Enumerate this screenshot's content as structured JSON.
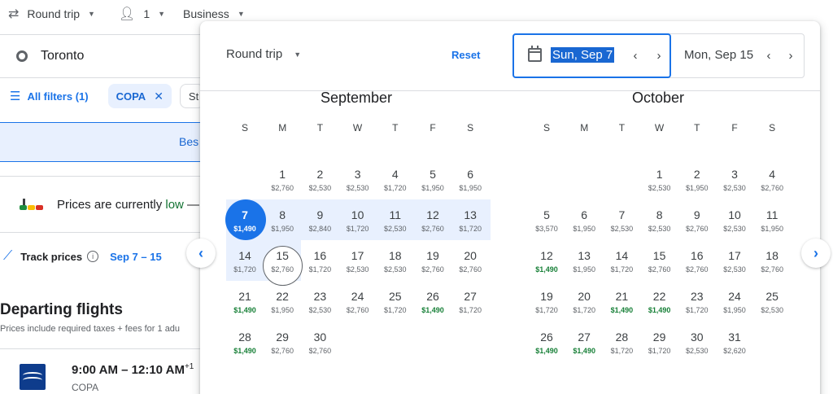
{
  "topbar": {
    "trip_type": "Round trip",
    "passengers": "1",
    "cabin": "Business"
  },
  "origin": "Toronto",
  "filters": {
    "all_filters": "All filters (1)",
    "chip": "COPA",
    "chip2": "St"
  },
  "best_tab": "Bes",
  "prices_notice": {
    "prefix": "Prices are currently ",
    "level": "low",
    "suffix": " —"
  },
  "track": {
    "label": "Track prices",
    "dates": "Sep 7 – 15"
  },
  "departing": {
    "title": "Departing flights",
    "subtitle": "Prices include required taxes + fees for 1 adu"
  },
  "flight": {
    "time": "9:00 AM – 12:10 AM",
    "day_offset": "+1",
    "airline": "COPA"
  },
  "dialog": {
    "trip_type": "Round trip",
    "reset": "Reset",
    "departure_date": "Sun, Sep 7",
    "return_date": "Mon, Sep 15"
  },
  "weekday_labels": [
    "S",
    "M",
    "T",
    "W",
    "T",
    "F",
    "S"
  ],
  "months": [
    {
      "name": "September",
      "first_weekday": 1,
      "days": [
        {
          "d": "1",
          "p": "$2,760"
        },
        {
          "d": "2",
          "p": "$2,530"
        },
        {
          "d": "3",
          "p": "$2,530"
        },
        {
          "d": "4",
          "p": "$1,720"
        },
        {
          "d": "5",
          "p": "$1,950"
        },
        {
          "d": "6",
          "p": "$1,950"
        },
        {
          "d": "7",
          "p": "$1,490",
          "cheap": true
        },
        {
          "d": "8",
          "p": "$1,950"
        },
        {
          "d": "9",
          "p": "$2,840"
        },
        {
          "d": "10",
          "p": "$1,720"
        },
        {
          "d": "11",
          "p": "$2,530"
        },
        {
          "d": "12",
          "p": "$2,760"
        },
        {
          "d": "13",
          "p": "$1,720"
        },
        {
          "d": "14",
          "p": "$1,720"
        },
        {
          "d": "15",
          "p": "$2,760"
        },
        {
          "d": "16",
          "p": "$1,720"
        },
        {
          "d": "17",
          "p": "$2,530"
        },
        {
          "d": "18",
          "p": "$2,530"
        },
        {
          "d": "19",
          "p": "$2,760"
        },
        {
          "d": "20",
          "p": "$2,760"
        },
        {
          "d": "21",
          "p": "$1,490",
          "cheap": true
        },
        {
          "d": "22",
          "p": "$1,950"
        },
        {
          "d": "23",
          "p": "$2,530"
        },
        {
          "d": "24",
          "p": "$2,760"
        },
        {
          "d": "25",
          "p": "$1,720"
        },
        {
          "d": "26",
          "p": "$1,490",
          "cheap": true
        },
        {
          "d": "27",
          "p": "$1,720"
        },
        {
          "d": "28",
          "p": "$1,490",
          "cheap": true
        },
        {
          "d": "29",
          "p": "$2,760"
        },
        {
          "d": "30",
          "p": "$2,760"
        }
      ]
    },
    {
      "name": "October",
      "first_weekday": 3,
      "days": [
        {
          "d": "1",
          "p": "$2,530"
        },
        {
          "d": "2",
          "p": "$1,950"
        },
        {
          "d": "3",
          "p": "$2,530"
        },
        {
          "d": "4",
          "p": "$2,760"
        },
        {
          "d": "5",
          "p": "$3,570"
        },
        {
          "d": "6",
          "p": "$1,950"
        },
        {
          "d": "7",
          "p": "$2,530"
        },
        {
          "d": "8",
          "p": "$2,530"
        },
        {
          "d": "9",
          "p": "$2,760"
        },
        {
          "d": "10",
          "p": "$2,530"
        },
        {
          "d": "11",
          "p": "$1,950"
        },
        {
          "d": "12",
          "p": "$1,490",
          "cheap": true
        },
        {
          "d": "13",
          "p": "$1,950"
        },
        {
          "d": "14",
          "p": "$1,720"
        },
        {
          "d": "15",
          "p": "$2,760"
        },
        {
          "d": "16",
          "p": "$2,760"
        },
        {
          "d": "17",
          "p": "$2,530"
        },
        {
          "d": "18",
          "p": "$2,760"
        },
        {
          "d": "19",
          "p": "$1,720"
        },
        {
          "d": "20",
          "p": "$1,720"
        },
        {
          "d": "21",
          "p": "$1,490",
          "cheap": true
        },
        {
          "d": "22",
          "p": "$1,490",
          "cheap": true
        },
        {
          "d": "23",
          "p": "$1,720"
        },
        {
          "d": "24",
          "p": "$1,950"
        },
        {
          "d": "25",
          "p": "$2,530"
        },
        {
          "d": "26",
          "p": "$1,490",
          "cheap": true
        },
        {
          "d": "27",
          "p": "$1,490",
          "cheap": true
        },
        {
          "d": "28",
          "p": "$1,720"
        },
        {
          "d": "29",
          "p": "$1,720"
        },
        {
          "d": "30",
          "p": "$2,530"
        },
        {
          "d": "31",
          "p": "$2,620"
        }
      ]
    }
  ],
  "colors": {
    "accent": "#1a73e8",
    "range": "#e8f0fe",
    "cheap": "#188038"
  }
}
